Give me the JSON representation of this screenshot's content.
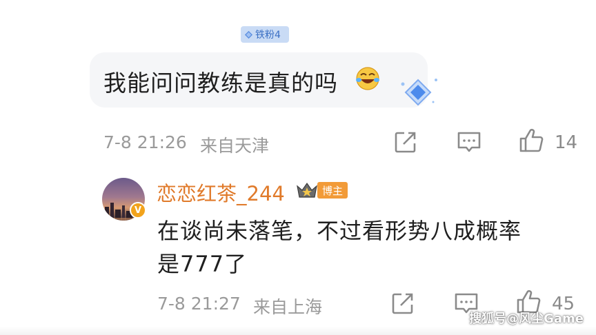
{
  "comment": {
    "fan_badge": "铁粉4",
    "text": "我能问问教练是真的吗",
    "date": "7-8 21:26",
    "location": "来自天津",
    "like_count": "14"
  },
  "reply": {
    "username": "恋恋红茶_244",
    "author_badge": "博主",
    "text_line1": "在谈尚未落笔，不过看形势八成概率",
    "text_line2": "是777了",
    "date": "7-8 21:27",
    "location": "来自上海",
    "like_count": "45"
  },
  "watermark": "搜狐号@风尘Game",
  "colors": {
    "username": "#e07a2a",
    "author_badge_bg": "#f29b38",
    "fan_badge_bg": "#c9dbf5",
    "meta_gray": "#9a9a9a"
  },
  "icons": [
    "diamond-icon",
    "laughing-emoji-icon",
    "gem-icon",
    "share-icon",
    "comment-icon",
    "like-icon",
    "verified-icon",
    "crown-icon"
  ]
}
